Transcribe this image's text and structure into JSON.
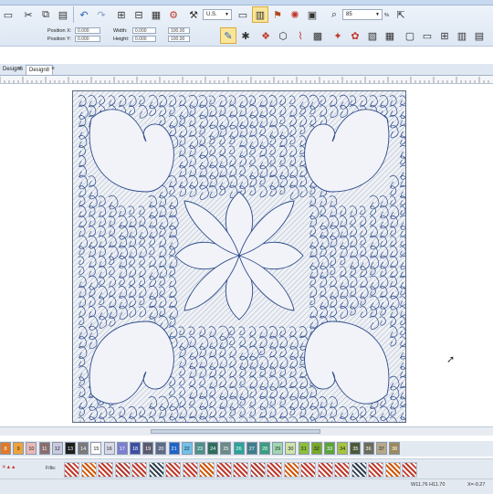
{
  "toolbar": {
    "units_dropdown": "U.S.",
    "zoom_value": "85",
    "zoom_unit": "%",
    "position_x_label": "Position X:",
    "position_y_label": "Position Y:",
    "position_x_value": "0.000",
    "position_y_value": "0.000",
    "width_label": "Width:",
    "height_label": "Height:",
    "width_value": "0.000",
    "height_value": "0.000",
    "width_pct": "100.00",
    "height_pct": "100.00"
  },
  "tabs": [
    {
      "label": "Design6"
    },
    {
      "label": "Design8"
    }
  ],
  "palette": {
    "swatches": [
      {
        "label": "8",
        "color": "#e07a2a",
        "text": "#fff"
      },
      {
        "label": "9",
        "color": "#f0a33a",
        "text": "#222"
      },
      {
        "label": "10",
        "color": "#e9b8b8",
        "text": "#222"
      },
      {
        "label": "11",
        "color": "#8a6d6d",
        "text": "#fff"
      },
      {
        "label": "12",
        "color": "#c9c9e2",
        "text": "#222"
      },
      {
        "label": "13",
        "color": "#1e1e1e",
        "text": "#fff"
      },
      {
        "label": "14",
        "color": "#7a7a7a",
        "text": "#fff"
      },
      {
        "label": "15",
        "color": "#ffffff",
        "text": "#222"
      },
      {
        "label": "16",
        "color": "#d9d9e8",
        "text": "#222"
      },
      {
        "label": "17",
        "color": "#7b7fd0",
        "text": "#fff"
      },
      {
        "label": "18",
        "color": "#3d4fa3",
        "text": "#fff"
      },
      {
        "label": "19",
        "color": "#5b5b6e",
        "text": "#fff"
      },
      {
        "label": "20",
        "color": "#5e6b84",
        "text": "#fff"
      },
      {
        "label": "21",
        "color": "#1e63c8",
        "text": "#fff"
      },
      {
        "label": "22",
        "color": "#6fc2ea",
        "text": "#222"
      },
      {
        "label": "23",
        "color": "#4f8f88",
        "text": "#fff"
      },
      {
        "label": "24",
        "color": "#2f6d5c",
        "text": "#fff"
      },
      {
        "label": "25",
        "color": "#6b8a86",
        "text": "#fff"
      },
      {
        "label": "26",
        "color": "#2aa59a",
        "text": "#fff"
      },
      {
        "label": "27",
        "color": "#3f7c8c",
        "text": "#fff"
      },
      {
        "label": "28",
        "color": "#3a9e80",
        "text": "#fff"
      },
      {
        "label": "29",
        "color": "#9fd7b1",
        "text": "#222"
      },
      {
        "label": "30",
        "color": "#cfe3a8",
        "text": "#222"
      },
      {
        "label": "31",
        "color": "#8bbf3a",
        "text": "#222"
      },
      {
        "label": "32",
        "color": "#77aa26",
        "text": "#222"
      },
      {
        "label": "33",
        "color": "#5da33a",
        "text": "#fff"
      },
      {
        "label": "34",
        "color": "#a8c33f",
        "text": "#222"
      },
      {
        "label": "35",
        "color": "#4c5a3a",
        "text": "#fff"
      },
      {
        "label": "36",
        "color": "#6b6b5a",
        "text": "#fff"
      },
      {
        "label": "37",
        "color": "#b6a88a",
        "text": "#222"
      },
      {
        "label": "38",
        "color": "#9c8a5e",
        "text": "#fff"
      }
    ]
  },
  "fills": {
    "label": "Fills:"
  },
  "status": {
    "size": "W11.76 H11.70",
    "coords": "X=-0.27"
  },
  "colors": {
    "stitch": "#2c4a8a",
    "hatch": "#7f8aa0",
    "selection_highlight": "#f9e69a"
  }
}
